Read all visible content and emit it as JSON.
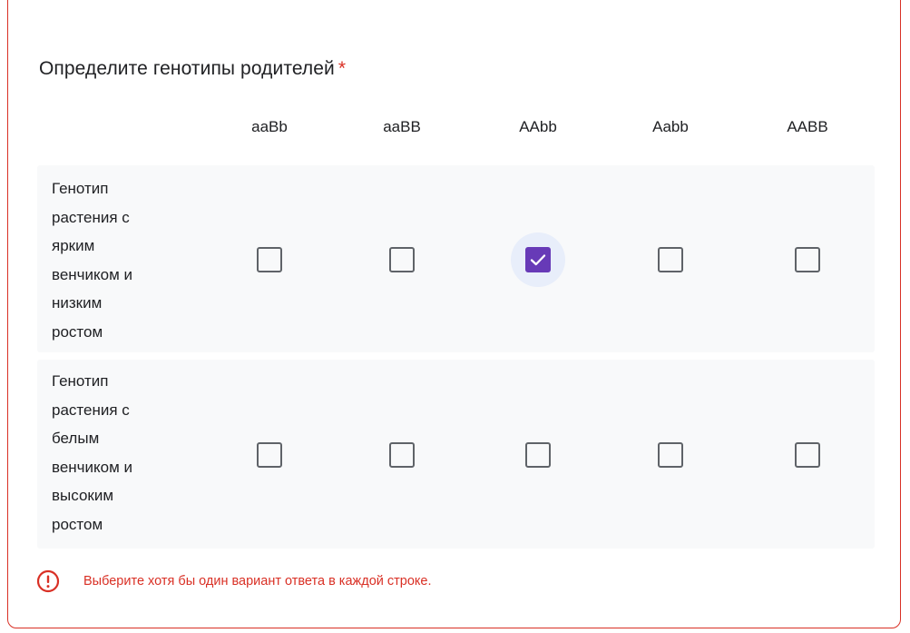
{
  "question": {
    "title": "Определите генотипы родителей",
    "required_mark": "*"
  },
  "columns": [
    "aaBb",
    "aaBB",
    "AAbb",
    "Aabb",
    "AABB"
  ],
  "rows": [
    {
      "label_lines": [
        "Генотип",
        "растения с",
        "ярким",
        "венчиком и",
        "низким",
        "ростом"
      ],
      "checked": [
        false,
        false,
        true,
        false,
        false
      ]
    },
    {
      "label_lines": [
        "Генотип",
        "растения с",
        "белым",
        "венчиком и",
        "высоким",
        "ростом"
      ],
      "checked": [
        false,
        false,
        false,
        false,
        false
      ]
    }
  ],
  "error": {
    "icon": "error-circle-icon",
    "text": "Выберите хотя бы один вариант ответа в каждой строке."
  },
  "colors": {
    "accent": "#673ab7",
    "error": "#d93025",
    "row_background": "#f8f9fa",
    "checked_halo": "#e8eefa"
  }
}
